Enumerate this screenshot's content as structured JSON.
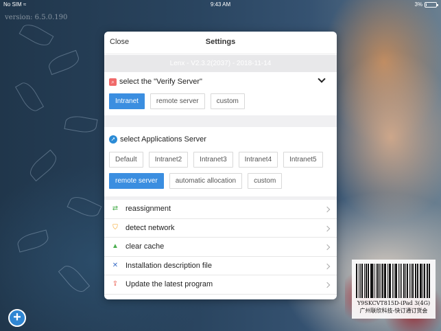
{
  "status_bar": {
    "carrier": "No SIM",
    "time": "9:43 AM",
    "battery_text": "3%",
    "battery_level": 0.03
  },
  "app_version": "version: 6.5.0.190",
  "modal": {
    "close_label": "Close",
    "title": "Settings",
    "version_banner": "Lenx - V2.3.2(2037) - 2018-11-14",
    "verify_section": {
      "heading": "select the \"Verify Server\"",
      "options": [
        {
          "label": "Intranet",
          "selected": true
        },
        {
          "label": "remote server",
          "selected": false
        },
        {
          "label": "custom",
          "selected": false
        }
      ]
    },
    "app_section": {
      "heading": "select Applications Server",
      "row1": [
        {
          "label": "Default",
          "selected": false
        },
        {
          "label": "Intranet2",
          "selected": false
        },
        {
          "label": "Intranet3",
          "selected": false
        },
        {
          "label": "Intranet4",
          "selected": false
        },
        {
          "label": "Intranet5",
          "selected": false
        }
      ],
      "row2": [
        {
          "label": "remote server",
          "selected": true
        },
        {
          "label": "automatic allocation",
          "selected": false
        },
        {
          "label": "custom",
          "selected": false
        }
      ]
    },
    "menu": [
      {
        "label": "reassignment",
        "icon": "refresh-icon",
        "color": "#4caf50"
      },
      {
        "label": "detect network",
        "icon": "shield-icon",
        "color": "#f39c12"
      },
      {
        "label": "clear cache",
        "icon": "broom-icon",
        "color": "#4caf50"
      },
      {
        "label": "Installation description file",
        "icon": "tools-icon",
        "color": "#3b6fc7"
      },
      {
        "label": "Update the latest program",
        "icon": "upload-icon",
        "color": "#e74c3c"
      }
    ]
  },
  "barcode": {
    "id": "Y9SKCVT815D-iPad 3(4G)",
    "company": "广州联欣科技-快订通订货会"
  },
  "colors": {
    "accent": "#3b8ee0",
    "fab": "#2f86d3"
  }
}
